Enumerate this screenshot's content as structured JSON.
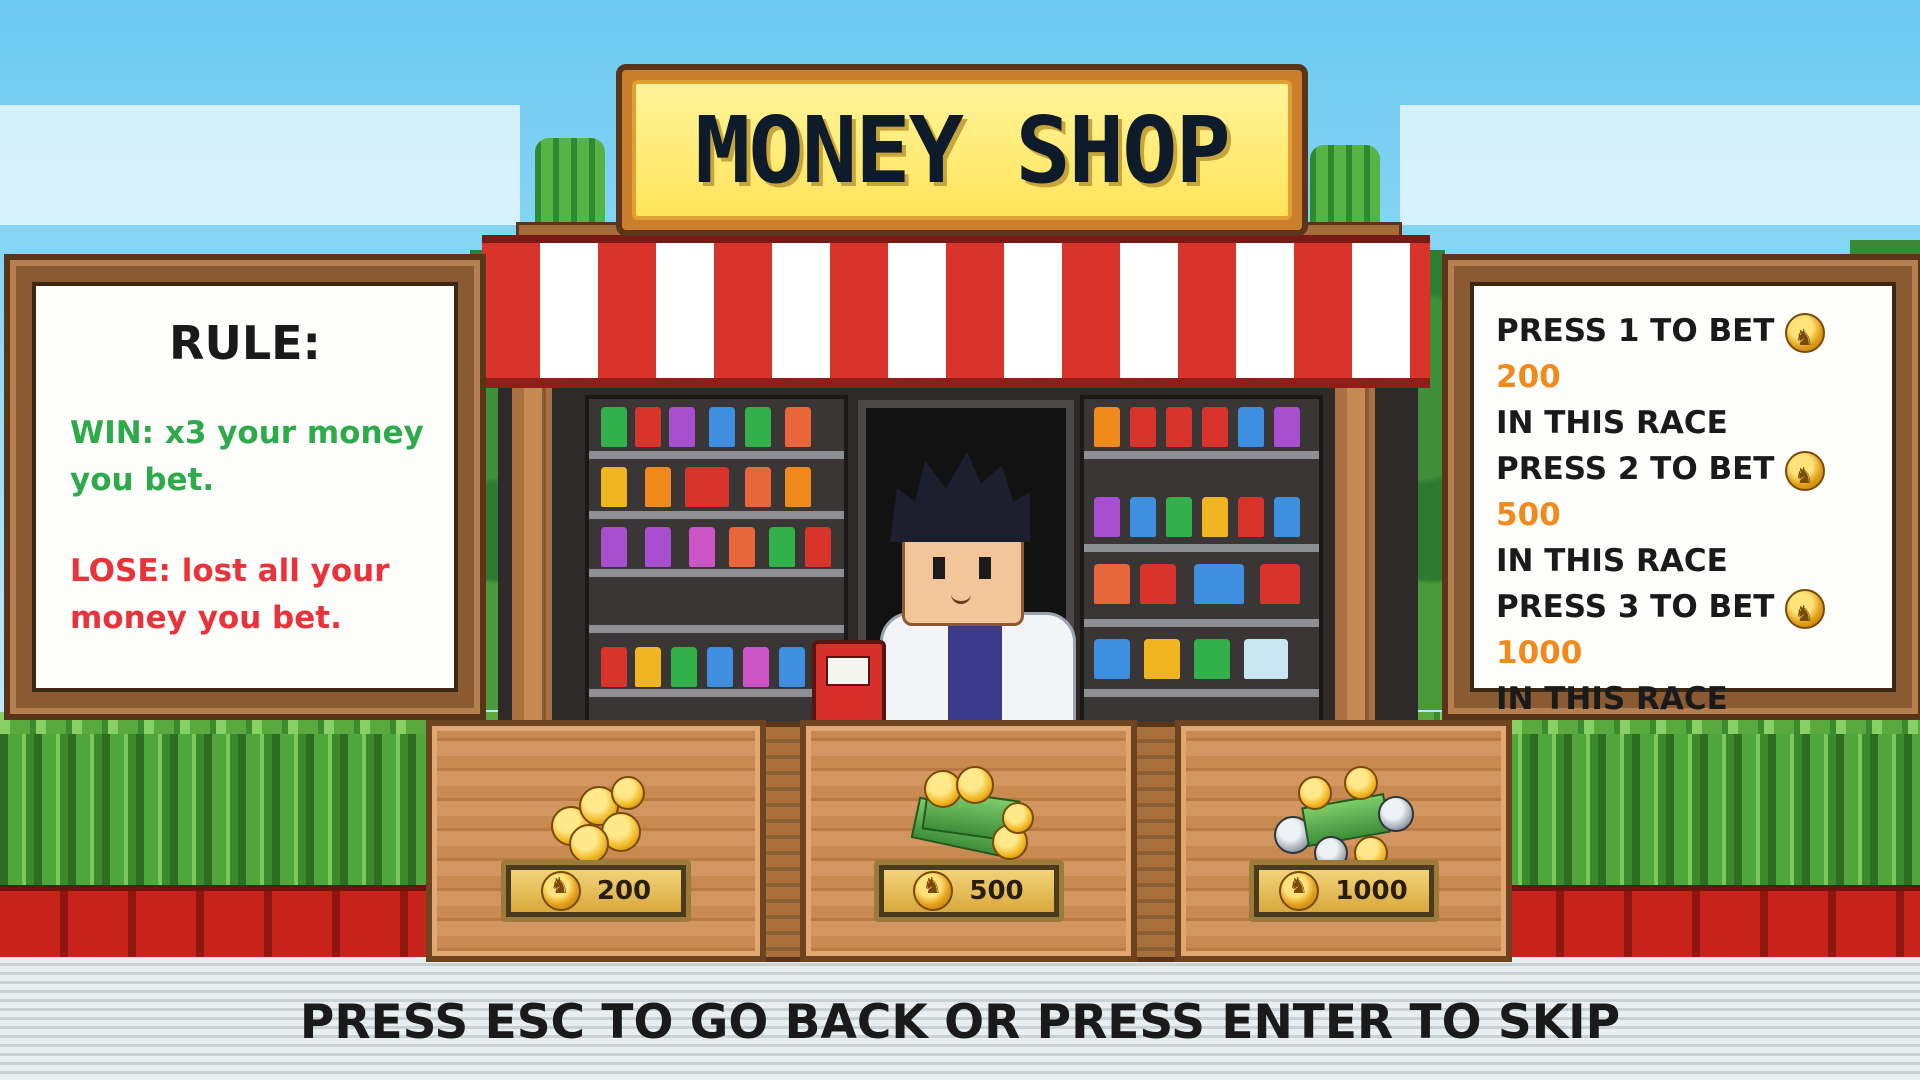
{
  "shop": {
    "title": "MONEY SHOP"
  },
  "rules": {
    "title": "RULE:",
    "win_text": "WIN: x3 your money you bet.",
    "lose_text": "LOSE: lost all your money you bet.",
    "win_color": "#2eaa4a",
    "lose_color": "#e8333a"
  },
  "bets": [
    {
      "prefix": "PRESS 1 TO BET",
      "amount": "200",
      "suffix": "IN THIS RACE"
    },
    {
      "prefix": "PRESS 2 TO BET",
      "amount": "500",
      "suffix": "IN THIS RACE"
    },
    {
      "prefix": "PRESS 3 TO BET",
      "amount": "1000",
      "suffix": "IN THIS RACE"
    }
  ],
  "offers": [
    {
      "price": "200"
    },
    {
      "price": "500"
    },
    {
      "price": "1000"
    }
  ],
  "footer": "PRESS ESC TO GO BACK OR PRESS ENTER TO SKIP",
  "icons": {
    "coin": "horse-coin-icon"
  },
  "colors": {
    "amount": "#f08a1c",
    "awning_red": "#d8342b"
  }
}
